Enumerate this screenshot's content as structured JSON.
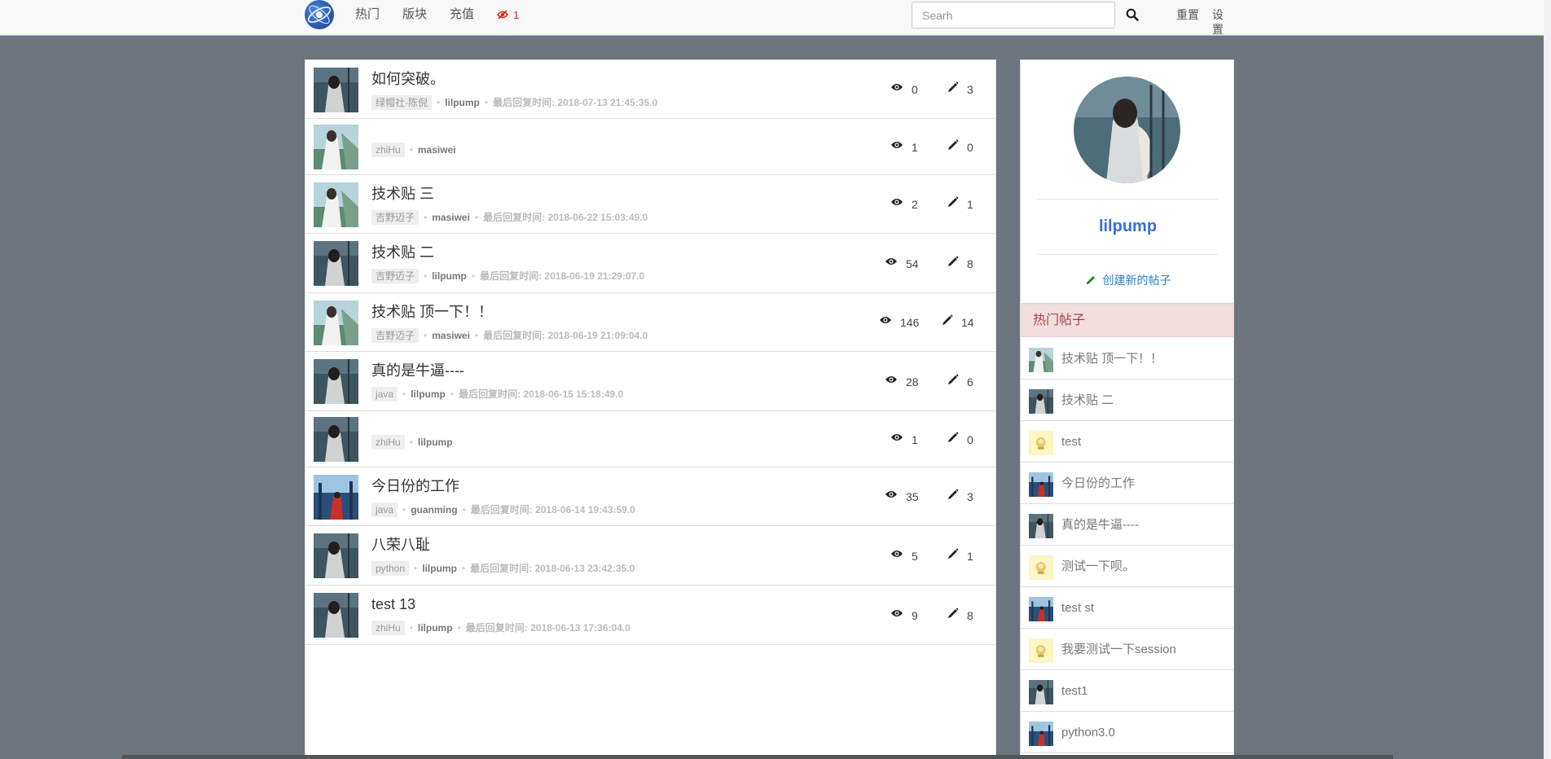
{
  "nav": {
    "links": [
      "热门",
      "版块",
      "充值"
    ],
    "badge_count": "1",
    "search_placeholder": "Searh",
    "reset_label": "重置",
    "settings_label": "设置"
  },
  "topics": [
    {
      "title": "如何突破。",
      "tag": "绿帽社-陈倪",
      "author": "lilpump",
      "reply_time": "最后回复时间: 2018-07-13 21:45:35.0",
      "views": "0",
      "replies": "3",
      "avatar": "dark"
    },
    {
      "title": "",
      "tag": "zhiHu",
      "author": "masiwei",
      "reply_time": "",
      "views": "1",
      "replies": "0",
      "avatar": "light"
    },
    {
      "title": "技术贴 三",
      "tag": "吉野迈子",
      "author": "masiwei",
      "reply_time": "最后回复时间: 2018-06-22 15:03:49.0",
      "views": "2",
      "replies": "1",
      "avatar": "light"
    },
    {
      "title": "技术贴 二",
      "tag": "吉野迈子",
      "author": "lilpump",
      "reply_time": "最后回复时间: 2018-06-19 21:29:07.0",
      "views": "54",
      "replies": "8",
      "avatar": "dark"
    },
    {
      "title": "技术贴 顶一下！！",
      "tag": "吉野迈子",
      "author": "masiwei",
      "reply_time": "最后回复时间: 2018-06-19 21:09:04.0",
      "views": "146",
      "replies": "14",
      "avatar": "light"
    },
    {
      "title": "真的是牛逼----",
      "tag": "java",
      "author": "lilpump",
      "reply_time": "最后回复时间: 2018-06-15 15:18:49.0",
      "views": "28",
      "replies": "6",
      "avatar": "dark"
    },
    {
      "title": "",
      "tag": "zhiHu",
      "author": "lilpump",
      "reply_time": "",
      "views": "1",
      "replies": "0",
      "avatar": "dark"
    },
    {
      "title": "今日份的工作",
      "tag": "java",
      "author": "guanming",
      "reply_time": "最后回复时间: 2018-06-14 19:43:59.0",
      "views": "35",
      "replies": "3",
      "avatar": "blue"
    },
    {
      "title": "八荣八耻",
      "tag": "python",
      "author": "lilpump",
      "reply_time": "最后回复时间: 2018-06-13 23:42:35.0",
      "views": "5",
      "replies": "1",
      "avatar": "dark"
    },
    {
      "title": "test 13",
      "tag": "zhiHu",
      "author": "lilpump",
      "reply_time": "最后回复时间: 2018-06-13 17:36:04.0",
      "views": "9",
      "replies": "8",
      "avatar": "dark"
    }
  ],
  "profile": {
    "name": "lilpump",
    "create_label": "创建新的帖子"
  },
  "hot": {
    "heading": "热门帖子",
    "items": [
      {
        "title": "技术贴 顶一下！！",
        "thumb": "light"
      },
      {
        "title": "技术贴 二",
        "thumb": "dark"
      },
      {
        "title": "test",
        "thumb": "yellow"
      },
      {
        "title": "今日份的工作",
        "thumb": "blue"
      },
      {
        "title": "真的是牛逼----",
        "thumb": "dark"
      },
      {
        "title": "测试一下呗。",
        "thumb": "yellow"
      },
      {
        "title": "test st",
        "thumb": "blue"
      },
      {
        "title": "我要测试一下session",
        "thumb": "yellow"
      },
      {
        "title": "test1",
        "thumb": "dark"
      },
      {
        "title": "python3.0",
        "thumb": "blue"
      }
    ]
  },
  "colors": {
    "background": "#6d747c",
    "accent_link": "#3a6fd8",
    "hot_heading_bg": "#f2dede",
    "hot_heading_text": "#a94442",
    "badge_red": "#d9230f"
  }
}
